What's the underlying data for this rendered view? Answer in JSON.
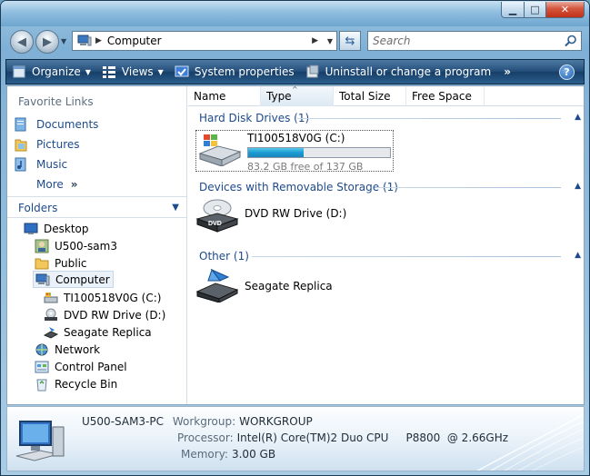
{
  "window": {
    "title": "Computer"
  },
  "navigation": {
    "back_label": "Back",
    "forward_label": "Forward",
    "address": {
      "path": "Computer"
    },
    "search": {
      "placeholder": "Search"
    }
  },
  "command_bar": {
    "items": [
      {
        "label": "Organize",
        "icon": "organize-icon",
        "dropdown": true
      },
      {
        "label": "Views",
        "icon": "views-icon",
        "dropdown": true
      },
      {
        "label": "System properties",
        "icon": "system-properties-icon",
        "dropdown": false
      },
      {
        "label": "Uninstall or change a program",
        "icon": "uninstall-icon",
        "dropdown": false
      }
    ],
    "more": "»",
    "help": "?"
  },
  "nav_pane": {
    "favorites_title": "Favorite Links",
    "favorites": [
      {
        "label": "Documents",
        "icon": "documents-icon"
      },
      {
        "label": "Pictures",
        "icon": "pictures-icon"
      },
      {
        "label": "Music",
        "icon": "music-icon"
      },
      {
        "label": "More",
        "icon": "",
        "chevron": "»"
      }
    ],
    "folders_title": "Folders",
    "tree": [
      {
        "label": "Desktop",
        "icon": "desktop-icon",
        "level": 0
      },
      {
        "label": "U500-sam3",
        "icon": "user-folder-icon",
        "level": 1
      },
      {
        "label": "Public",
        "icon": "folder-icon",
        "level": 1
      },
      {
        "label": "Computer",
        "icon": "computer-icon",
        "level": 1,
        "selected": true
      },
      {
        "label": "TI100518V0G (C:)",
        "icon": "hard-drive-icon",
        "level": 2
      },
      {
        "label": "DVD RW Drive (D:)",
        "icon": "dvd-drive-icon",
        "level": 2
      },
      {
        "label": "Seagate Replica",
        "icon": "seagate-icon",
        "level": 2
      },
      {
        "label": "Network",
        "icon": "network-icon",
        "level": 1
      },
      {
        "label": "Control Panel",
        "icon": "control-panel-icon",
        "level": 1
      },
      {
        "label": "Recycle Bin",
        "icon": "recycle-bin-icon",
        "level": 1
      }
    ]
  },
  "columns": [
    "Name",
    "Type",
    "Total Size",
    "Free Space"
  ],
  "groups": [
    {
      "title": "Hard Disk Drives (1)",
      "items": [
        {
          "name": "TI100518V0G (C:)",
          "free_text": "83.2 GB free of 137 GB",
          "used_fraction": 0.39
        }
      ]
    },
    {
      "title": "Devices with Removable Storage (1)",
      "items": [
        {
          "name": "DVD RW Drive (D:)"
        }
      ]
    },
    {
      "title": "Other (1)",
      "items": [
        {
          "name": "Seagate Replica"
        }
      ]
    }
  ],
  "details": {
    "computer_name": "U500-SAM3-PC",
    "workgroup_label": "Workgroup:",
    "workgroup_value": "WORKGROUP",
    "processor_label": "Processor:",
    "processor_value": "Intel(R) Core(TM)2 Duo CPU     P8800  @ 2.66GHz",
    "memory_label": "Memory:",
    "memory_value": "3.00 GB"
  },
  "colors": {
    "link": "#1d4a8c",
    "command_bar": "#1c4a76",
    "capacity_fill": "#1b9bd2"
  }
}
